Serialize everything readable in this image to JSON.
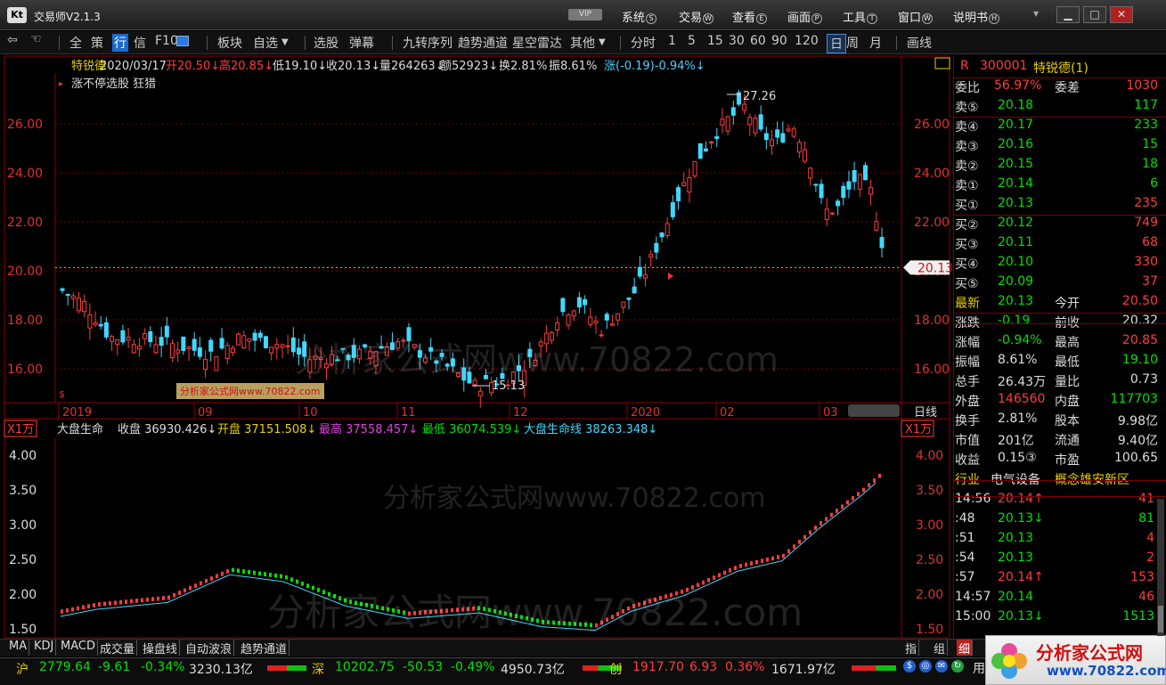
{
  "app": {
    "logo": "Kt",
    "name": "交易师V2.1.3",
    "vip": "VIP"
  },
  "menu": [
    {
      "label": "系统",
      "key": "S"
    },
    {
      "label": "交易",
      "key": "W"
    },
    {
      "label": "查看",
      "key": "E"
    },
    {
      "label": "画面",
      "key": "P"
    },
    {
      "label": "工具",
      "key": "T"
    },
    {
      "label": "窗口",
      "key": "W"
    },
    {
      "label": "说明书",
      "key": "H"
    }
  ],
  "toolbar": {
    "items": [
      "全",
      "策",
      "行",
      "信",
      "F10",
      "板块",
      "自选",
      "选股",
      "弹幕",
      "九转序列",
      "趋势通道",
      "星空雷达",
      "其他",
      "分时",
      "1",
      "5",
      "15",
      "30",
      "60",
      "90",
      "120",
      "日",
      "周",
      "月",
      "画线"
    ]
  },
  "stock_header": {
    "name": "特锐德",
    "date": "2020/03/17",
    "open": "开20.50↓",
    "high": "高20.85↓",
    "low": "低19.10↓",
    "close": "收20.13↓",
    "vol": "量264263↓",
    "amt": "额52923↓",
    "turn": "换2.81%",
    "amp": "振8.61%",
    "chg": "涨(-0.19)-0.94%↓",
    "line2": "涨不停选股  狂猎"
  },
  "price_axis": [
    "26.00",
    "24.00",
    "22.00",
    "20.00",
    "18.00",
    "16.00"
  ],
  "date_axis": [
    "2019",
    "09",
    "10",
    "11",
    "12",
    "2020",
    "02",
    "03"
  ],
  "labels": {
    "hi": "27.26",
    "lo": "15.13",
    "cur": "20.13",
    "period": "日线",
    "mark": "$",
    "watermark_small": "分析家公式网www.70822.com"
  },
  "indicator": {
    "unit": "X1万",
    "name": "大盘生命",
    "close": "收盘 36930.426↓",
    "open": "开盘 37151.508↓",
    "high": "最高 37558.457↓",
    "low": "最低 36074.539↓",
    "line": "大盘生命线 38263.348↓",
    "axis": [
      "4.00",
      "3.50",
      "3.00",
      "2.50",
      "2.00",
      "1.50"
    ]
  },
  "watermarks": [
    "分析家公式网www.70822.com",
    "分析家公式网www.70822.com",
    "分析家公式网www.70822.com"
  ],
  "quote": {
    "r_badge": "R",
    "code": "300001",
    "name": "特锐德(1)",
    "weibi_label": "委比",
    "weibi": "56.97%",
    "weicha_label": "委差",
    "weicha": "1030",
    "asks": [
      {
        "l": "卖⑤",
        "p": "20.18",
        "v": "117"
      },
      {
        "l": "卖④",
        "p": "20.17",
        "v": "233"
      },
      {
        "l": "卖③",
        "p": "20.16",
        "v": "15"
      },
      {
        "l": "卖②",
        "p": "20.15",
        "v": "18"
      },
      {
        "l": "卖①",
        "p": "20.14",
        "v": "6"
      }
    ],
    "bids": [
      {
        "l": "买①",
        "p": "20.13",
        "v": "235"
      },
      {
        "l": "买②",
        "p": "20.12",
        "v": "749"
      },
      {
        "l": "买③",
        "p": "20.11",
        "v": "68"
      },
      {
        "l": "买④",
        "p": "20.10",
        "v": "330"
      },
      {
        "l": "买⑤",
        "p": "20.09",
        "v": "37"
      }
    ],
    "stats": [
      {
        "l1": "最新",
        "v1": "20.13",
        "l2": "今开",
        "v2": "20.50"
      },
      {
        "l1": "涨跌",
        "v1": "-0.19",
        "l2": "前收",
        "v2": "20.32"
      },
      {
        "l1": "涨幅",
        "v1": "-0.94%",
        "l2": "最高",
        "v2": "20.85"
      },
      {
        "l1": "振幅",
        "v1": "8.61%",
        "l2": "最低",
        "v2": "19.10"
      },
      {
        "l1": "总手",
        "v1": "26.43万",
        "l2": "量比",
        "v2": "0.73"
      },
      {
        "l1": "外盘",
        "v1": "146560",
        "l2": "内盘",
        "v2": "117703"
      }
    ],
    "stats2": [
      {
        "l1": "换手",
        "v1": "2.81%",
        "l2": "股本",
        "v2": "9.98亿"
      },
      {
        "l1": "市值",
        "v1": "201亿",
        "l2": "流通",
        "v2": "9.40亿"
      },
      {
        "l1": "收益",
        "v1": "0.15③",
        "l2": "市盈",
        "v2": "100.65"
      }
    ],
    "industry_label": "行业",
    "industry": "电气设备",
    "concept": "概念雄安新区",
    "ticks": [
      {
        "t": "14:56",
        "p": "20.14↑",
        "v": "41"
      },
      {
        "t": ":48",
        "p": "20.13↓",
        "v": "81"
      },
      {
        "t": ":51",
        "p": "20.13",
        "v": "4"
      },
      {
        "t": ":54",
        "p": "20.13",
        "v": "2"
      },
      {
        "t": ":57",
        "p": "20.14↑",
        "v": "153"
      },
      {
        "t": "14:57",
        "p": "20.14",
        "v": "46"
      },
      {
        "t": "15:00",
        "p": "20.13↓",
        "v": "1513"
      }
    ]
  },
  "bottom_tabs": [
    "MA",
    "KDJ",
    "MACD",
    "成交量",
    "操盘线",
    "自动波浪",
    "趋势通道"
  ],
  "bottom_right": [
    "指",
    "组",
    "细"
  ],
  "status": {
    "sh_label": "沪",
    "sh": "2779.64",
    "sh_chg": "-9.61",
    "sh_pct": "-0.34%",
    "sh_amt": "3230.13亿",
    "sz_label": "深",
    "sz": "10202.75",
    "sz_chg": "-50.53",
    "sz_pct": "-0.49%",
    "sz_amt": "4950.73亿",
    "cy_label": "创",
    "cy": "1917.70",
    "cy_chg": "6.93",
    "cy_pct": "0.36%",
    "cy_amt": "1671.97亿",
    "use": "用",
    "brand": "分析家公式网",
    "brand_url": "www.70822.com"
  }
}
